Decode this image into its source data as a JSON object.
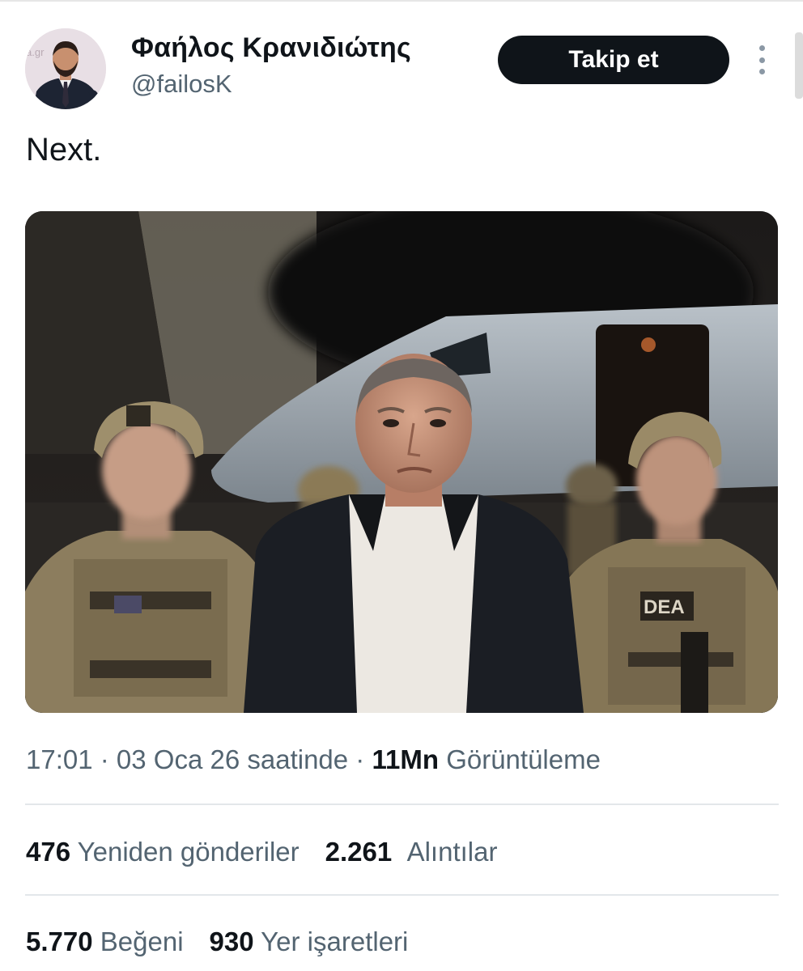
{
  "author": {
    "display_name": "Φαήλος Κρανιδιώτης",
    "handle": "@failosK",
    "avatar_watermark": "a.gr"
  },
  "follow_button_label": "Takip et",
  "more_icon": "more-vertical-icon",
  "tweet": {
    "text": "Next."
  },
  "media": {
    "patch_label": "DEA"
  },
  "meta": {
    "time": "17:01",
    "separator1": " · ",
    "date": "03 Oca 26 saatinde",
    "separator2": " · ",
    "views_count": "11Mn",
    "views_label": "Görüntüleme"
  },
  "stats": {
    "reposts_count": "476",
    "reposts_label": "Yeniden gönderiler",
    "quotes_count": "2.261",
    "quotes_label": "Alıntılar",
    "likes_count": "5.770",
    "likes_label": "Beğeni",
    "bookmarks_count": "930",
    "bookmarks_label": "Yer işaretleri"
  },
  "colors": {
    "text_primary": "#0f1419",
    "text_secondary": "#536471",
    "button_bg": "#0f1419",
    "divider": "#e3e7ea"
  }
}
